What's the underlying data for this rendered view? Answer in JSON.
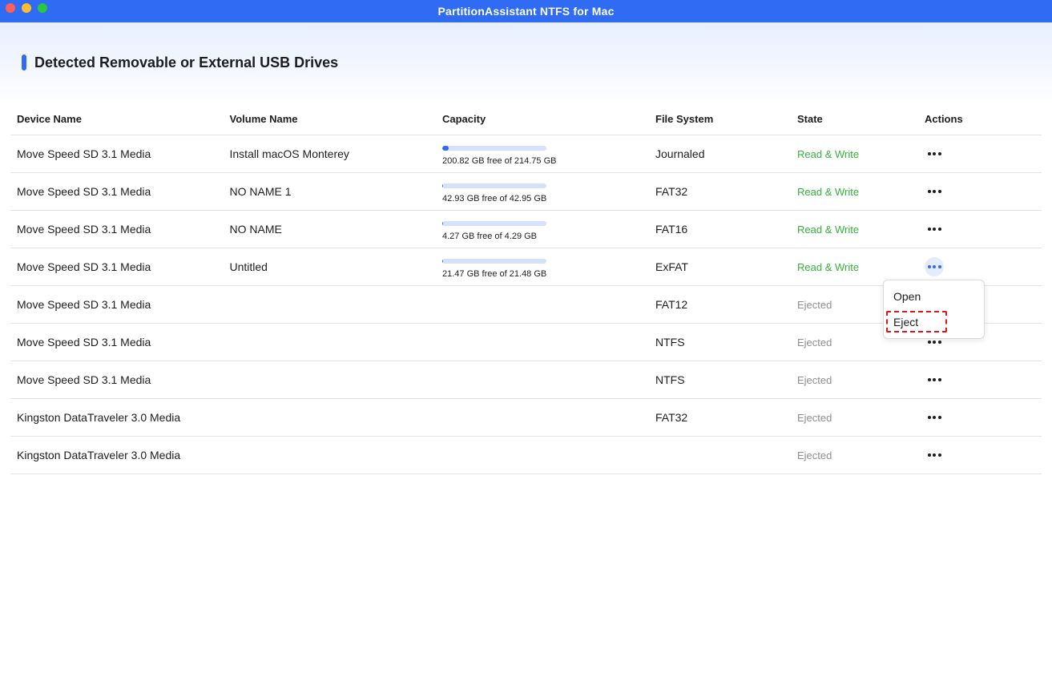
{
  "window": {
    "title": "PartitionAssistant NTFS for Mac"
  },
  "section": {
    "title": "Detected Removable or External USB Drives"
  },
  "table": {
    "headers": [
      "Device Name",
      "Volume Name",
      "Capacity",
      "File System",
      "State",
      "Actions"
    ],
    "rows": [
      {
        "device": "Move Speed SD 3.1 Media",
        "volume": "Install macOS Monterey",
        "capacity_text": "200.82 GB free of 214.75 GB",
        "used_fraction": 0.065,
        "fs": "Journaled",
        "state": "Read & Write",
        "state_type": "rw"
      },
      {
        "device": "Move Speed SD 3.1 Media",
        "volume": "NO NAME 1",
        "capacity_text": "42.93 GB free of 42.95 GB",
        "used_fraction": 0.0005,
        "fs": "FAT32",
        "state": "Read & Write",
        "state_type": "rw"
      },
      {
        "device": "Move Speed SD 3.1 Media",
        "volume": "NO NAME",
        "capacity_text": "4.27 GB free of 4.29 GB",
        "used_fraction": 0.005,
        "fs": "FAT16",
        "state": "Read & Write",
        "state_type": "rw"
      },
      {
        "device": "Move Speed SD 3.1 Media",
        "volume": "Untitled",
        "capacity_text": "21.47 GB free of 21.48 GB",
        "used_fraction": 0.0005,
        "fs": "ExFAT",
        "state": "Read & Write",
        "state_type": "rw",
        "menu_active": true
      },
      {
        "device": "Move Speed SD 3.1 Media",
        "volume": "",
        "capacity_text": "",
        "fs": "FAT12",
        "state": "Ejected",
        "state_type": "ej"
      },
      {
        "device": "Move Speed SD 3.1 Media",
        "volume": "",
        "capacity_text": "",
        "fs": "NTFS",
        "state": "Ejected",
        "state_type": "ej"
      },
      {
        "device": "Move Speed SD 3.1 Media",
        "volume": "",
        "capacity_text": "",
        "fs": "NTFS",
        "state": "Ejected",
        "state_type": "ej"
      },
      {
        "device": "Kingston DataTraveler 3.0 Media",
        "volume": "",
        "capacity_text": "",
        "fs": "FAT32",
        "state": "Ejected",
        "state_type": "ej"
      },
      {
        "device": "Kingston DataTraveler 3.0 Media",
        "volume": "",
        "capacity_text": "",
        "fs": "",
        "state": "Ejected",
        "state_type": "ej"
      }
    ]
  },
  "context_menu": {
    "open_label": "Open",
    "eject_label": "Eject"
  },
  "colors": {
    "accent": "#2f6bf3",
    "read_write": "#34b33a",
    "ejected": "#8e8e93",
    "highlight": "#e0161b"
  }
}
